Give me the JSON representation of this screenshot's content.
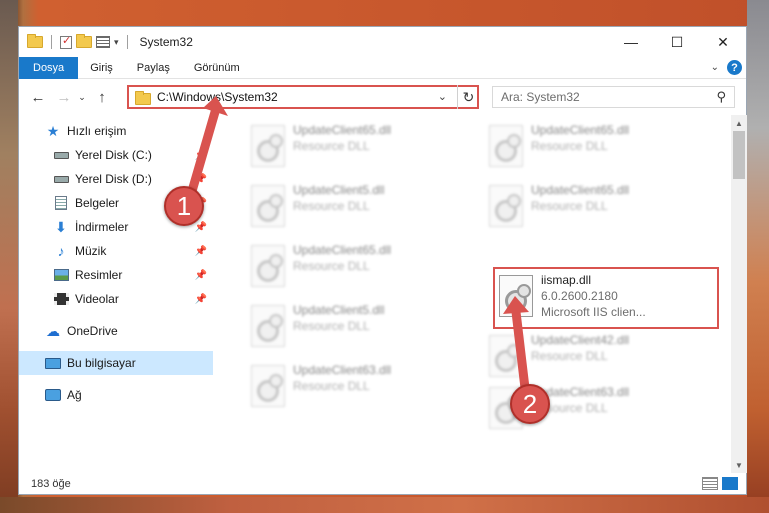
{
  "window": {
    "title": "System32",
    "controls": {
      "minimize": "—",
      "maximize": "☐",
      "close": "✕"
    }
  },
  "ribbon": {
    "tabs": [
      {
        "label": "Dosya",
        "active": true
      },
      {
        "label": "Giriş"
      },
      {
        "label": "Paylaş"
      },
      {
        "label": "Görünüm"
      }
    ],
    "help": "?"
  },
  "navigation": {
    "back": "←",
    "forward": "→",
    "recent": "⌄",
    "up": "↑",
    "address": "C:\\Windows\\System32",
    "refresh": "↻",
    "search_placeholder": "Ara: System32"
  },
  "sidebar": {
    "items": [
      {
        "label": "Hızlı erişim",
        "icon": "quick-access-star-icon"
      },
      {
        "label": "Yerel Disk (C:)",
        "icon": "drive-icon",
        "pinned": true
      },
      {
        "label": "Yerel Disk (D:)",
        "icon": "drive-icon",
        "pinned": true
      },
      {
        "label": "Belgeler",
        "icon": "documents-icon",
        "pinned": true
      },
      {
        "label": "İndirmeler",
        "icon": "downloads-icon",
        "pinned": true
      },
      {
        "label": "Müzik",
        "icon": "music-icon",
        "pinned": true
      },
      {
        "label": "Resimler",
        "icon": "pictures-icon",
        "pinned": true
      },
      {
        "label": "Videolar",
        "icon": "videos-icon",
        "pinned": true
      },
      {
        "label": "OneDrive",
        "icon": "onedrive-icon"
      },
      {
        "label": "Bu bilgisayar",
        "icon": "this-pc-icon",
        "selected": true
      },
      {
        "label": "Ağ",
        "icon": "network-icon"
      }
    ]
  },
  "files": [
    {
      "name": "UpdateClient65.dll",
      "line1": "Resource DLL",
      "line2": ""
    },
    {
      "name": "UpdateClient65.dll",
      "line1": "Resource DLL",
      "line2": ""
    },
    {
      "name": "UpdateClient5.dll",
      "line1": "Resource DLL",
      "line2": ""
    },
    {
      "name": "UpdateClient65.dll",
      "line1": "Resource DLL",
      "line2": ""
    },
    {
      "name": "UpdateClient65.dll",
      "line1": "Resource DLL",
      "line2": ""
    },
    {
      "name": "iismap.dll",
      "line1": "6.0.2600.2180",
      "line2": "Microsoft IIS clien..."
    },
    {
      "name": "UpdateClient5.dll",
      "line1": "Resource DLL",
      "line2": ""
    },
    {
      "name": "UpdateClient42.dll",
      "line1": "Resource DLL",
      "line2": ""
    },
    {
      "name": "UpdateClient63.dll",
      "line1": "Resource DLL",
      "line2": ""
    },
    {
      "name": "UpdateClient63.dll",
      "line1": "Resource DLL",
      "line2": ""
    }
  ],
  "status": {
    "count": "183 öğe"
  },
  "annotations": {
    "badge1": "1",
    "badge2": "2"
  },
  "colors": {
    "accent": "#1979ca",
    "highlight": "#d9534f",
    "selection": "#cce8ff"
  }
}
